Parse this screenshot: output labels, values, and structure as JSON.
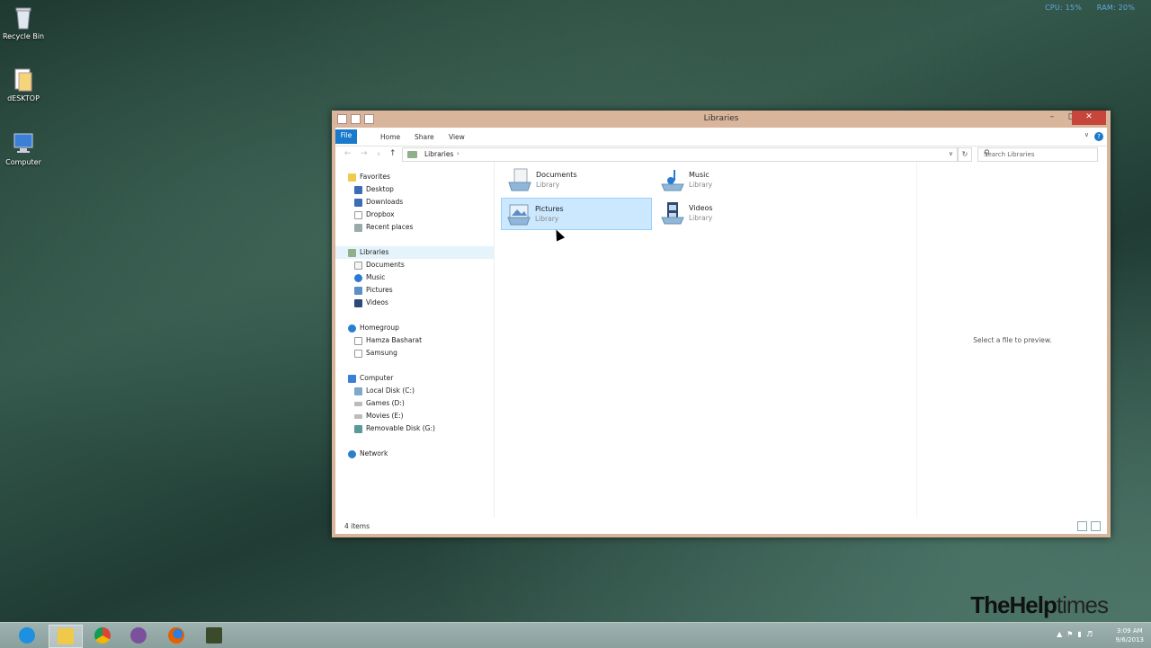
{
  "desktop": {
    "icons": [
      {
        "label": "Recycle Bin",
        "icon": "recycle-bin-icon"
      },
      {
        "label": "dESKTOP",
        "icon": "folder-icon"
      },
      {
        "label": "Computer",
        "icon": "computer-icon"
      }
    ],
    "sysmon": {
      "cpu": "CPU: 15%",
      "ram": "RAM: 20%"
    },
    "watermark": {
      "bold": "TheHelp",
      "thin": "times"
    }
  },
  "window": {
    "title": "Libraries",
    "ribbon": {
      "file": "File",
      "home": "Home",
      "share": "Share",
      "view": "View",
      "help": "?"
    },
    "address": {
      "segment": "Libraries"
    },
    "search": {
      "placeholder": "Search Libraries"
    },
    "nav": {
      "favorites": "Favorites",
      "fav_items": [
        "Desktop",
        "Downloads",
        "Dropbox",
        "Recent places"
      ],
      "libraries": "Libraries",
      "lib_items": [
        "Documents",
        "Music",
        "Pictures",
        "Videos"
      ],
      "homegroup": "Homegroup",
      "home_items": [
        "Hamza Basharat",
        "Samsung"
      ],
      "computer": "Computer",
      "comp_items": [
        "Local Disk (C:)",
        "Games (D:)",
        "Movies (E:)",
        "Removable Disk (G:)"
      ],
      "network": "Network"
    },
    "tiles": [
      {
        "name": "Documents",
        "sub": "Library"
      },
      {
        "name": "Music",
        "sub": "Library"
      },
      {
        "name": "Pictures",
        "sub": "Library"
      },
      {
        "name": "Videos",
        "sub": "Library"
      }
    ],
    "preview": "Select a file to preview.",
    "status": "4 items"
  },
  "taskbar": {
    "apps": [
      "internet-explorer-icon",
      "file-explorer-icon",
      "chrome-icon",
      "viber-icon",
      "firefox-icon",
      "app-icon"
    ],
    "time": "3:09 AM",
    "date": "9/6/2013"
  }
}
